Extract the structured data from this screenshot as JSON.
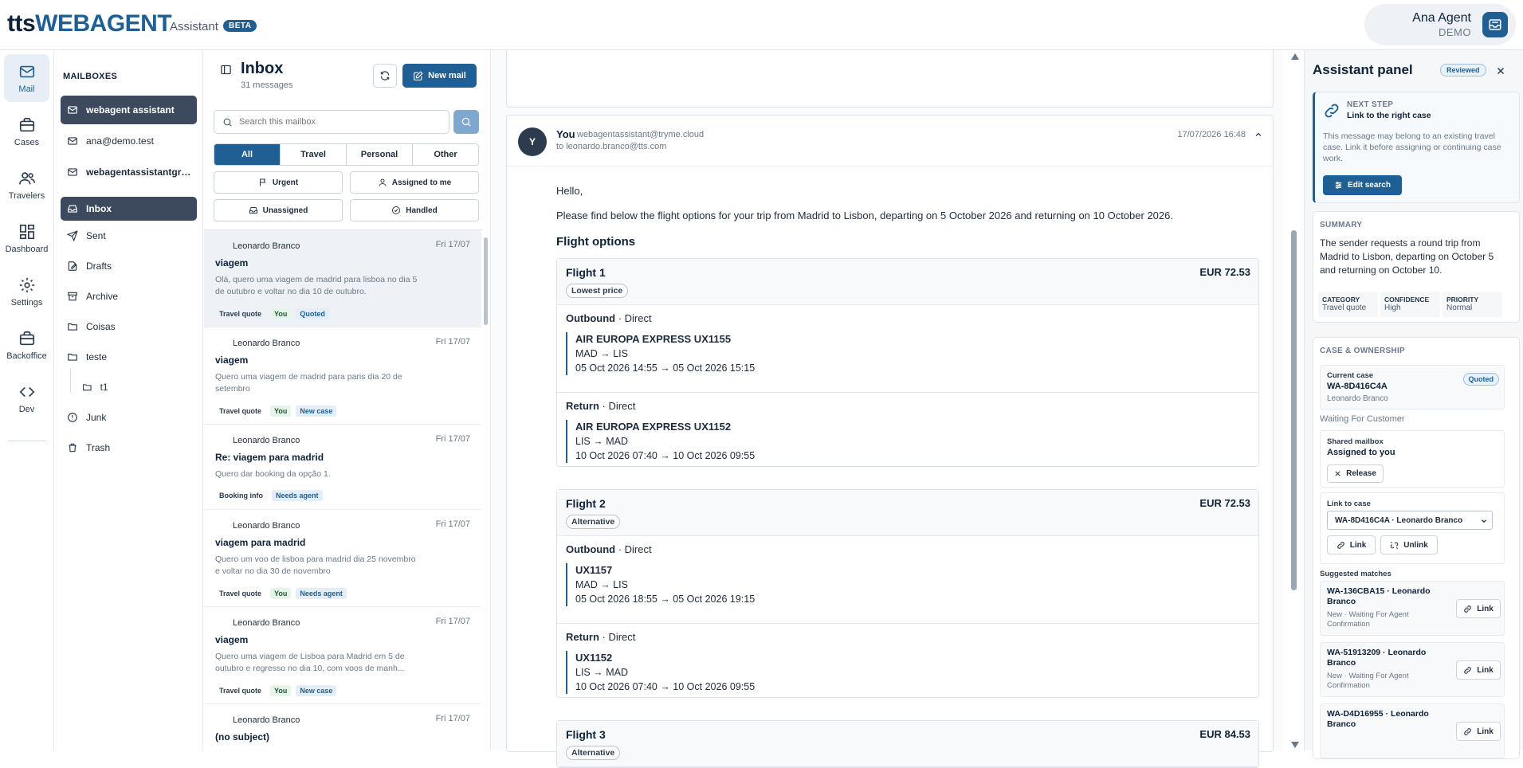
{
  "app": {
    "logo_tts": "tts",
    "logo_web": "WEBAGENT",
    "name": "Assistant",
    "badge": "BETA",
    "user_name": "Ana Agent",
    "user_org": "DEMO"
  },
  "rail": [
    {
      "label": "Mail",
      "icon": "mail-icon"
    },
    {
      "label": "Cases",
      "icon": "briefcase-icon"
    },
    {
      "label": "Travelers",
      "icon": "users-icon"
    },
    {
      "label": "Dashboard",
      "icon": "dashboard-icon"
    },
    {
      "label": "Settings",
      "icon": "gear-icon"
    },
    {
      "label": "Backoffice",
      "icon": "briefcase-icon"
    },
    {
      "label": "Dev",
      "icon": "code-icon"
    }
  ],
  "mailboxes": {
    "title": "MAILBOXES",
    "items": [
      {
        "label": "webagent assistant"
      },
      {
        "label": "ana@demo.test"
      },
      {
        "label": "webagentassistantgro..."
      }
    ],
    "folders": [
      {
        "label": "Inbox"
      },
      {
        "label": "Sent"
      },
      {
        "label": "Drafts"
      },
      {
        "label": "Archive"
      },
      {
        "label": "Coisas"
      },
      {
        "label": "teste"
      },
      {
        "label": "t1"
      },
      {
        "label": "Junk"
      },
      {
        "label": "Trash"
      }
    ]
  },
  "list": {
    "title": "Inbox",
    "count": "31 messages",
    "new_mail": "New mail",
    "search_placeholder": "Search this mailbox",
    "tabs": [
      "All",
      "Travel",
      "Personal",
      "Other"
    ],
    "filters": [
      "Urgent",
      "Assigned to me",
      "Unassigned",
      "Handled"
    ],
    "messages": [
      {
        "from": "Leonardo Branco",
        "date": "Fri 17/07",
        "subject": "viagem",
        "preview": "Olá, quero uma viagem de madrid para lisboa no dia 5 de outubro e voltar no dia 10 de outubro.",
        "tags": [
          "Travel quote",
          "You",
          "Quoted"
        ]
      },
      {
        "from": "Leonardo Branco",
        "date": "Fri 17/07",
        "subject": "viagem",
        "preview": "Quero uma viagem de madrid para paris dia 20 de setembro",
        "tags": [
          "Travel quote",
          "You",
          "New case"
        ]
      },
      {
        "from": "Leonardo Branco",
        "date": "Fri 17/07",
        "subject": "Re: viagem para madrid",
        "preview": "Quero dar booking da opção 1.",
        "tags": [
          "Booking info",
          "Needs agent"
        ]
      },
      {
        "from": "Leonardo Branco",
        "date": "Fri 17/07",
        "subject": "viagem para madrid",
        "preview": "Quero um voo de lisboa para madrid dia 25 novembro e voltar no dia 30 de novembro",
        "tags": [
          "Travel quote",
          "You",
          "Needs agent"
        ]
      },
      {
        "from": "Leonardo Branco",
        "date": "Fri 17/07",
        "subject": "viagem",
        "preview": "Quero uma viagem de Lisboa para Madrid em 5 de outubro e regresso no dia 10, com voos de manh...",
        "tags": [
          "Travel quote",
          "You",
          "New case"
        ]
      },
      {
        "from": "Leonardo Branco",
        "date": "Fri 17/07",
        "subject": "(no subject)",
        "preview": "",
        "tags": []
      }
    ]
  },
  "mail": {
    "avatar": "Y",
    "from_name": "You",
    "from_addr": "webagentassistant@tryme.cloud",
    "to": "to leonardo.branco@tts.com",
    "date": "17/07/2026 16:48",
    "greeting": "Hello,",
    "intro": "Please find below the flight options for your trip from Madrid to Lisbon, departing on 5 October 2026 and returning on 10 October 2026.",
    "options_heading": "Flight options",
    "flights": [
      {
        "title": "Flight 1",
        "price": "EUR 72.53",
        "badge": "Lowest price",
        "out_label": "Outbound",
        "out_type": "· Direct",
        "out_carrier": "AIR EUROPA EXPRESS UX1155",
        "out_route": "MAD → LIS",
        "out_time": "05 Oct 2026 14:55 → 05 Oct 2026 15:15",
        "ret_label": "Return",
        "ret_type": "· Direct",
        "ret_carrier": "AIR EUROPA EXPRESS UX1152",
        "ret_route": "LIS → MAD",
        "ret_time": "10 Oct 2026 07:40 → 10 Oct 2026 09:55"
      },
      {
        "title": "Flight 2",
        "price": "EUR 72.53",
        "badge": "Alternative",
        "out_label": "Outbound",
        "out_type": "· Direct",
        "out_carrier": "UX1157",
        "out_route": "MAD → LIS",
        "out_time": "05 Oct 2026 18:55 → 05 Oct 2026 19:15",
        "ret_label": "Return",
        "ret_type": "· Direct",
        "ret_carrier": "UX1152",
        "ret_route": "LIS → MAD",
        "ret_time": "10 Oct 2026 07:40 → 10 Oct 2026 09:55"
      },
      {
        "title": "Flight 3",
        "price": "EUR 84.53",
        "badge": "Alternative"
      }
    ]
  },
  "assistant": {
    "title": "Assistant panel",
    "reviewed": "Reviewed",
    "next_step_caption": "NEXT STEP",
    "next_step_title": "Link to the right case",
    "next_step_text": "This message may belong to an existing travel case. Link it before assigning or continuing case work.",
    "edit_search": "Edit search",
    "summary_caption": "SUMMARY",
    "summary_text": "The sender requests a round trip from Madrid to Lisbon, departing on October 5 and returning on October 10.",
    "category_label": "CATEGORY",
    "category": "Travel quote",
    "confidence_label": "CONFIDENCE",
    "confidence": "High",
    "priority_label": "PRIORITY",
    "priority": "Normal",
    "case_caption": "CASE & OWNERSHIP",
    "current_case_label": "Current case",
    "current_case_id": "WA-8D416C4A",
    "current_case_person": "Leonardo Branco",
    "current_case_badge": "Quoted",
    "waiting": "Waiting For Customer",
    "shared_label": "Shared mailbox",
    "shared_value": "Assigned to you",
    "release": "Release",
    "link_case_label": "Link to case",
    "link_case_value": "WA-8D416C4A · Leonardo Branco",
    "link": "Link",
    "unlink": "Unlink",
    "suggested_label": "Suggested matches",
    "suggestions": [
      {
        "title": "WA-136CBA15 · Leonardo Branco",
        "status": "New · Waiting For Agent Confirmation",
        "action": "Link"
      },
      {
        "title": "WA-51913209 · Leonardo Branco",
        "status": "New · Waiting For Agent Confirmation",
        "action": "Link"
      },
      {
        "title": "WA-D4D16955 · Leonardo Branco",
        "status": "",
        "action": "Link"
      }
    ]
  }
}
